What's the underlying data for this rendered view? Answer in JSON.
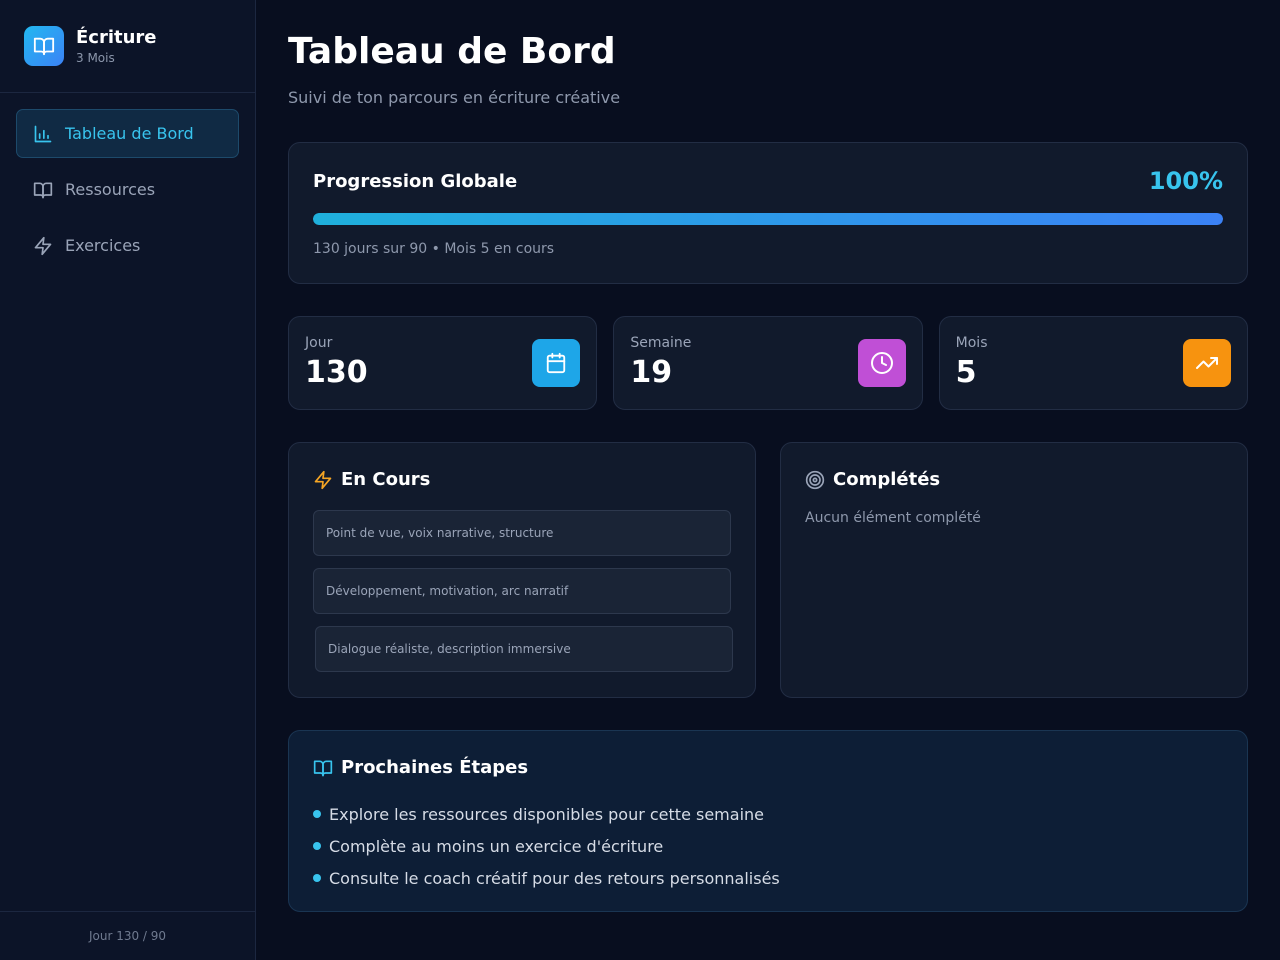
{
  "sidebar": {
    "brand_title": "Écriture",
    "brand_sub": "3 Mois",
    "items": [
      {
        "label": "Tableau de Bord",
        "icon": "bar-chart-icon",
        "active": true
      },
      {
        "label": "Ressources",
        "icon": "book-open-icon",
        "active": false
      },
      {
        "label": "Exercices",
        "icon": "lightning-icon",
        "active": false
      }
    ],
    "footer": "Jour 130 / 90"
  },
  "header": {
    "title": "Tableau de Bord",
    "subtitle": "Suivi de ton parcours en écriture créative"
  },
  "progress": {
    "title": "Progression Globale",
    "percent_label": "100%",
    "percent": 100,
    "note": "130 jours sur 90 • Mois 5 en cours"
  },
  "stats": [
    {
      "label": "Jour",
      "value": "130",
      "icon": "calendar-icon",
      "color": "#1ea6e8"
    },
    {
      "label": "Semaine",
      "value": "19",
      "icon": "clock-icon",
      "color": "#c04fd6"
    },
    {
      "label": "Mois",
      "value": "5",
      "icon": "trending-up-icon",
      "color": "#f7930f"
    }
  ],
  "in_progress": {
    "title": "En Cours",
    "items": [
      "Point de vue, voix narrative, structure",
      "Développement, motivation, arc narratif",
      "Dialogue réaliste, description immersive"
    ]
  },
  "completed": {
    "title": "Complétés",
    "empty": "Aucun élément complété"
  },
  "next_steps": {
    "title": "Prochaines Étapes",
    "items": [
      "Explore les ressources disponibles pour cette semaine",
      "Complète au moins un exercice d'écriture",
      "Consulte le coach créatif pour des retours personnalisés"
    ]
  },
  "colors": {
    "accent": "#38c4ee",
    "background": "#080e1f",
    "card": "#111a2c"
  }
}
